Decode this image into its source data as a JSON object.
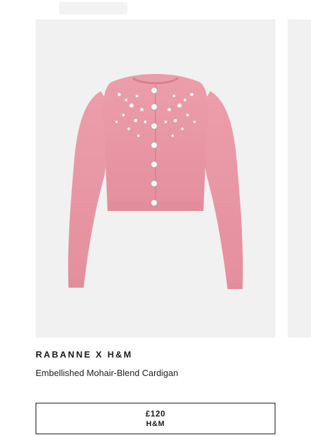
{
  "product": {
    "brand": "RABANNE X H&M",
    "name": "Embellished Mohair-Blend Cardigan",
    "image_icon": "pink-embellished-cardigan",
    "price": "£120",
    "retailer": "H&M"
  },
  "colors": {
    "image_bg": "#f1f1f1",
    "cardigan": "#e99aa6",
    "border": "#1a1a1a"
  }
}
